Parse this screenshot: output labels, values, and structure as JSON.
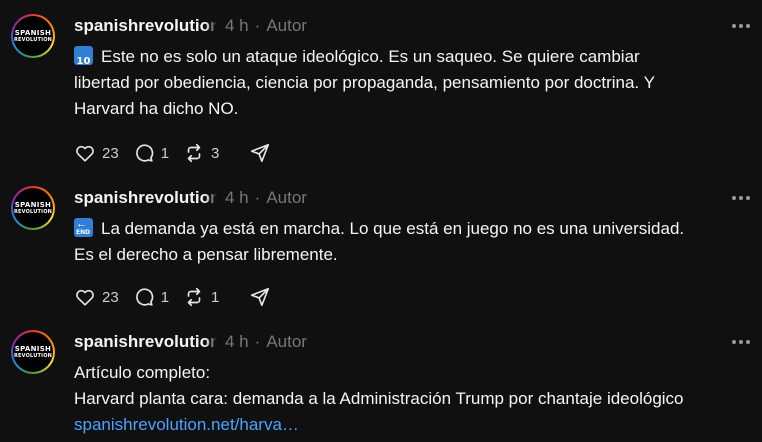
{
  "posts": [
    {
      "avatar": {
        "line1": "SPANISH",
        "line2": "REVOLUTION"
      },
      "username": "spanishrevolution",
      "time": "4 h",
      "separator": "·",
      "role": "Autor",
      "emoji": {
        "kind": "keycap-10",
        "label": "10"
      },
      "text_lines": [
        "Este no es solo un ataque ideológico. Es un saqueo. Se quiere cambiar",
        "libertad por obediencia, ciencia por propaganda, pensamiento por doctrina. Y",
        "Harvard ha dicho NO."
      ],
      "likes": "23",
      "comments": "1",
      "reposts": "3"
    },
    {
      "avatar": {
        "line1": "SPANISH",
        "line2": "REVOLUTION"
      },
      "username": "spanishrevolution",
      "time": "4 h",
      "separator": "·",
      "role": "Autor",
      "emoji": {
        "kind": "end-arrow",
        "label": "END"
      },
      "text_lines": [
        "La demanda ya está en marcha. Lo que está en juego no es una universidad.",
        "Es el derecho a pensar libremente."
      ],
      "likes": "23",
      "comments": "1",
      "reposts": "1"
    },
    {
      "avatar": {
        "line1": "SPANISH",
        "line2": "REVOLUTION"
      },
      "username": "spanishrevolution",
      "time": "4 h",
      "separator": "·",
      "role": "Autor",
      "text_lines": [
        "Artículo completo:",
        "Harvard planta cara: demanda a la Administración Trump por chantaje ideológico"
      ],
      "link": "spanishrevolution.net/harva…"
    }
  ],
  "icons": [
    "heart-icon",
    "comment-icon",
    "repost-icon",
    "share-icon",
    "more-icon"
  ],
  "colors": {
    "background": "#101010",
    "text": "#f3f5f7",
    "muted": "#777777",
    "link": "#4aa3ff",
    "emoji": "#2f7fd6"
  }
}
